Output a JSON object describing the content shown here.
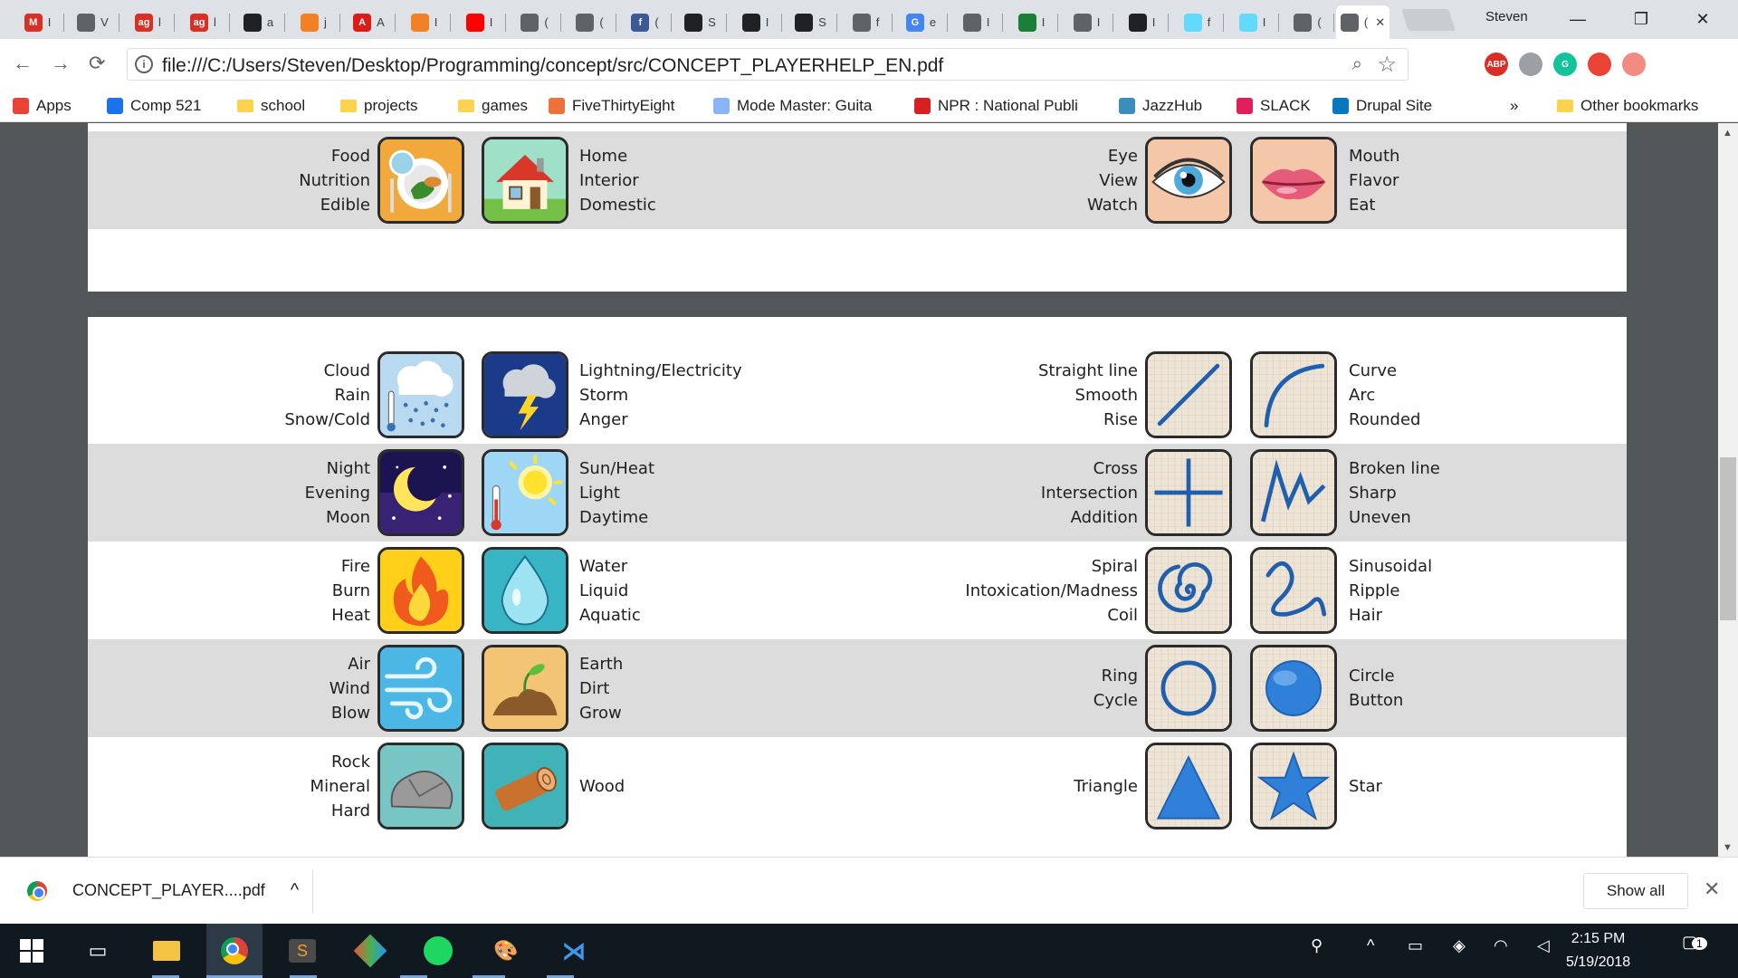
{
  "tabs": [
    {
      "icon": "gmail-icon",
      "label": "M",
      "color": "#d93025",
      "text": "I"
    },
    {
      "icon": "doc-icon",
      "label": "",
      "color": "#5f6368",
      "text": "V"
    },
    {
      "icon": "ag-icon",
      "label": "ag",
      "color": "#d93025",
      "text": "l"
    },
    {
      "icon": "ag-icon",
      "label": "ag",
      "color": "#d93025",
      "text": "l"
    },
    {
      "icon": "github-icon",
      "label": "",
      "color": "#202124",
      "text": "a"
    },
    {
      "icon": "stack-icon",
      "label": "",
      "color": "#f48024",
      "text": "j"
    },
    {
      "icon": "angular-icon",
      "label": "A",
      "color": "#dd1b16",
      "text": "A"
    },
    {
      "icon": "stack-icon",
      "label": "",
      "color": "#f48024",
      "text": "I"
    },
    {
      "icon": "youtube-icon",
      "label": "",
      "color": "#ff0000",
      "text": "I"
    },
    {
      "icon": "doc-icon",
      "label": "",
      "color": "#5f6368",
      "text": "("
    },
    {
      "icon": "doc-icon",
      "label": "",
      "color": "#5f6368",
      "text": "("
    },
    {
      "icon": "facebook-icon",
      "label": "f",
      "color": "#3b5998",
      "text": "("
    },
    {
      "icon": "atom-icon",
      "label": "",
      "color": "#202124",
      "text": "S"
    },
    {
      "icon": "atom-icon",
      "label": "",
      "color": "#202124",
      "text": "I"
    },
    {
      "icon": "github-icon",
      "label": "",
      "color": "#202124",
      "text": "S"
    },
    {
      "icon": "doc-icon",
      "label": "",
      "color": "#5f6368",
      "text": "f"
    },
    {
      "icon": "google-icon",
      "label": "G",
      "color": "#4285f4",
      "text": "e"
    },
    {
      "icon": "doc-icon",
      "label": "",
      "color": "#5f6368",
      "text": "I"
    },
    {
      "icon": "terminal-icon",
      "label": "",
      "color": "#1a7f37",
      "text": "I"
    },
    {
      "icon": "doc-icon",
      "label": "",
      "color": "#5f6368",
      "text": "I"
    },
    {
      "icon": "github-icon",
      "label": "",
      "color": "#202124",
      "text": "I"
    },
    {
      "icon": "react-icon",
      "label": "",
      "color": "#61dafb",
      "text": "f"
    },
    {
      "icon": "react-icon",
      "label": "",
      "color": "#61dafb",
      "text": "I"
    },
    {
      "icon": "doc-icon",
      "label": "",
      "color": "#5f6368",
      "text": "("
    },
    {
      "icon": "pdf-icon",
      "label": "",
      "color": "#5f6368",
      "text": "("
    }
  ],
  "profile_name": "Steven",
  "window_controls": {
    "minimize": "—",
    "restore": "❐",
    "close": "✕"
  },
  "url": "file:///C:/Users/Steven/Desktop/Programming/concept/src/CONCEPT_PLAYERHELP_EN.pdf",
  "extensions": [
    {
      "name": "abp-icon",
      "label": "ABP",
      "color": "#d93025"
    },
    {
      "name": "puzzle-icon",
      "label": "",
      "color": "#9aa0a6"
    },
    {
      "name": "grammarly-icon",
      "label": "G",
      "color": "#15c39a"
    },
    {
      "name": "gift-icon",
      "label": "",
      "color": "#ea4335"
    },
    {
      "name": "arrow-ext-icon",
      "label": "",
      "color": "#f28b82"
    }
  ],
  "bookmarks": [
    {
      "label": "Apps",
      "icon": "apps-icon",
      "color": "#ea4335"
    },
    {
      "label": "Comp 521",
      "icon": "gear-icon",
      "color": "#1a73e8"
    },
    {
      "label": "school",
      "icon": "folder-icon",
      "color": "#fbd34f"
    },
    {
      "label": "projects",
      "icon": "folder-icon",
      "color": "#fbd34f"
    },
    {
      "label": "games",
      "icon": "folder-icon",
      "color": "#fbd34f"
    },
    {
      "label": "FiveThirtyEight",
      "icon": "fte-icon",
      "color": "#ed713a"
    },
    {
      "label": "Mode Master: Guita",
      "icon": "globe-icon",
      "color": "#8ab4f8"
    },
    {
      "label": "NPR : National Publi",
      "icon": "npr-icon",
      "color": "#d62021"
    },
    {
      "label": "JazzHub",
      "icon": "jazzhub-icon",
      "color": "#3c8dbc"
    },
    {
      "label": "SLACK",
      "icon": "slack-icon",
      "color": "#e01e5a"
    },
    {
      "label": "Drupal Site",
      "icon": "drupal-icon",
      "color": "#0678be"
    }
  ],
  "bookmarks_more": "»",
  "other_bookmarks": "Other bookmarks",
  "page1": {
    "rows": [
      {
        "grey": true,
        "left_words": "Food\nNutrition\nEdible",
        "left_icon": "food-icon",
        "mid_icon": "home-icon",
        "mid_words": "Home\nInterior\nDomestic",
        "right_words": "Eye\nView\nWatch",
        "right_icon": "eye-icon",
        "far_icon": "mouth-icon",
        "far_words": "Mouth\nFlavor\nEat"
      }
    ]
  },
  "page2": {
    "rows": [
      {
        "grey": false,
        "left_words": "Cloud\nRain\nSnow/Cold",
        "left_icon": "cloud-rain-icon",
        "mid_icon": "lightning-icon",
        "mid_words": "Lightning/Electricity\nStorm\nAnger",
        "right_words": "Straight line\nSmooth\nRise",
        "right_icon": "straight-line-icon",
        "far_icon": "curve-icon",
        "far_words": "Curve\nArc\nRounded"
      },
      {
        "grey": true,
        "left_words": "Night\nEvening\nMoon",
        "left_icon": "moon-icon",
        "mid_icon": "sun-icon",
        "mid_words": "Sun/Heat\nLight\nDaytime",
        "right_words": "Cross\nIntersection\nAddition",
        "right_icon": "cross-icon",
        "far_icon": "broken-line-icon",
        "far_words": "Broken line\nSharp\nUneven"
      },
      {
        "grey": false,
        "left_words": "Fire\nBurn\nHeat",
        "left_icon": "fire-icon",
        "mid_icon": "water-icon",
        "mid_words": "Water\nLiquid\nAquatic",
        "right_words": "Spiral\nIntoxication/Madness\nCoil",
        "right_icon": "spiral-icon",
        "far_icon": "sinusoid-icon",
        "far_words": "Sinusoidal\nRipple\nHair"
      },
      {
        "grey": true,
        "left_words": "Air\nWind\nBlow",
        "left_icon": "wind-icon",
        "mid_icon": "earth-icon",
        "mid_words": "Earth\nDirt\nGrow",
        "right_words": "Ring\nCycle",
        "right_icon": "ring-icon",
        "far_icon": "circle-icon",
        "far_words": "Circle\nButton"
      },
      {
        "grey": false,
        "left_words": "Rock\nMineral\nHard",
        "left_icon": "rock-icon",
        "mid_icon": "wood-icon",
        "mid_words": "Wood",
        "right_words": "Triangle",
        "right_icon": "triangle-icon",
        "far_icon": "star-icon",
        "far_words": "Star"
      }
    ]
  },
  "download": {
    "filename": "CONCEPT_PLAYER....pdf",
    "chevron": "^",
    "show_all": "Show all",
    "close": "✕"
  },
  "taskbar": {
    "time": "2:15 PM",
    "date": "5/19/2018",
    "notifications": "1"
  },
  "colors": {
    "accent": "#1a73e8",
    "grey_row": "#dcdcdc",
    "pdf_bg": "#525659",
    "taskbar": "#101820"
  }
}
